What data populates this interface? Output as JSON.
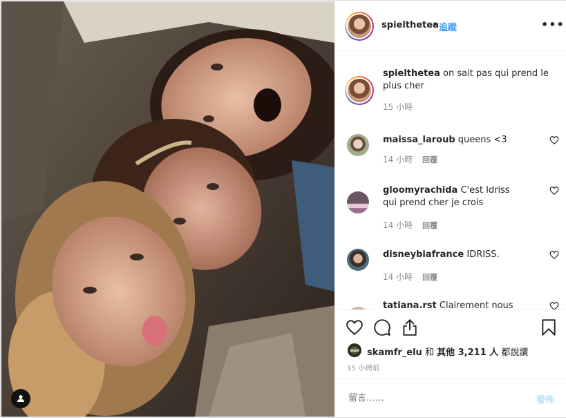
{
  "post": {
    "username": "spielthetea",
    "separator": "•",
    "follow_label": "追蹤",
    "more_icon": "more-icon",
    "caption": {
      "username": "spielthetea",
      "text": "on sait pas qui prend le plus cher",
      "time": "15 小時"
    },
    "comments": [
      {
        "username": "maissa_laroub",
        "text": "queens <3",
        "time": "14 小時",
        "reply": "回覆"
      },
      {
        "username": "gloomyrachida",
        "text": "C'est Idriss qui prend cher je crois",
        "time": "14 小時",
        "reply": "回覆"
      },
      {
        "username": "disneybiafrance",
        "text": "IDRISS.",
        "time": "14 小時",
        "reply": "回覆"
      },
      {
        "username": "tatiana.rst",
        "text": "Clairement nous a la",
        "time": "",
        "reply": ""
      }
    ],
    "likes": {
      "liker": "skamfr_elu",
      "and": "和",
      "others": "其他 3,211 人",
      "suffix": "都說讚",
      "liker_avatar_text": "SKAM"
    },
    "time_ago": "15 小時前",
    "add_comment_placeholder": "留言……",
    "post_button": "發佈"
  },
  "colors": {
    "link_blue": "#3897f0",
    "post_disabled": "#b2dffc",
    "muted": "#8e8e8e",
    "text": "#262626"
  }
}
